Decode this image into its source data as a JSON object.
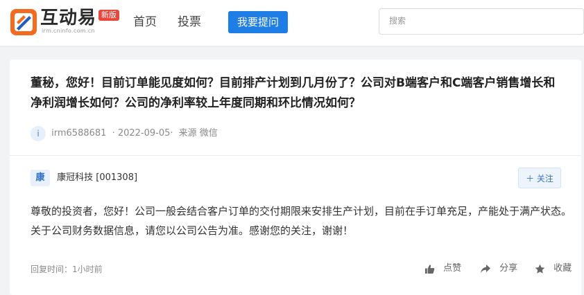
{
  "header": {
    "logo_text": "互动易",
    "logo_sub": "irm.cninfo.com.cn",
    "new_badge": "新版",
    "nav": [
      "首页",
      "投票"
    ],
    "ask_button": "我要提问",
    "search_placeholder": "搜索"
  },
  "question": {
    "text": "董秘，您好！目前订单能见度如何？目前排产计划到几月份了？公司对B端客户和C端客户销售增长和净利润增长如何？公司的净利率较上年度同期和环比情况如何？",
    "avatar_letter": "i",
    "user": "irm6588681",
    "date": "· 2022-09-05·",
    "source": "来源 微信"
  },
  "answer": {
    "company_badge": "康",
    "company": "康冠科技 [001308]",
    "follow_label": "关注",
    "text": "尊敬的投资者，您好！公司一般会结合客户订单的交付期限来安排生产计划，目前在手订单充足，产能处于满产状态。关于公司财务数据信息，请您以公司公告为准。感谢您的关注，谢谢！",
    "reply_time": "回复时间：1小时前",
    "like_label": "点赞",
    "share_label": "分享",
    "collect_label": "收藏"
  },
  "colors": {
    "accent": "#1e7ee6",
    "badge_red": "#e8453c",
    "logo_orange": "#f26b21"
  }
}
